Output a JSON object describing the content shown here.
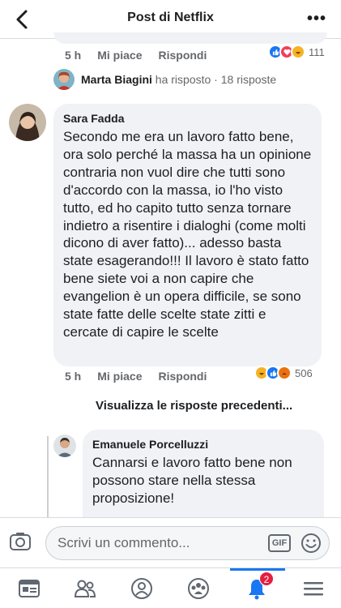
{
  "header": {
    "title": "Post di Netflix",
    "more": "•••"
  },
  "top_comment": {
    "time": "5 h",
    "like_label": "Mi piace",
    "reply_label": "Rispondi",
    "reaction_count": "111"
  },
  "reply_summary": {
    "name": "Marta Biagini",
    "action": "ha risposto",
    "separator": "·",
    "count": "18 risposte"
  },
  "comment": {
    "author": "Sara Fadda",
    "text": "Secondo me era un lavoro fatto bene, ora solo perché la massa ha un opinione contraria non vuol dire che tutti sono d'accordo con la massa, io l'ho visto tutto, ed ho capito tutto senza tornare indietro a risentire i dialoghi (come molti dicono di aver fatto)... adesso basta state esagerando!!! Il lavoro è stato fatto bene siete voi a non capire che evangelion  è un opera difficile, se sono state fatte delle scelte state zitti e cercate di capire le scelte",
    "time": "5 h",
    "like_label": "Mi piace",
    "reply_label": "Rispondi",
    "reaction_count": "506"
  },
  "view_previous": "Visualizza le risposte precedenti...",
  "reply": {
    "author": "Emanuele Porcelluzzi",
    "text": "Cannarsi e lavoro fatto bene non possono stare nella stessa proposizione!"
  },
  "composer": {
    "placeholder": "Scrivi un commento...",
    "gif_label": "GIF"
  },
  "tabbar": {
    "notification_badge": "2",
    "accent": "#1877f2"
  },
  "colors": {
    "bubble": "#f0f2f5",
    "like": "#1877f2",
    "love": "#f33e58",
    "haha": "#f7b125",
    "angry": "#e9710f",
    "badge": "#e41e3f"
  }
}
